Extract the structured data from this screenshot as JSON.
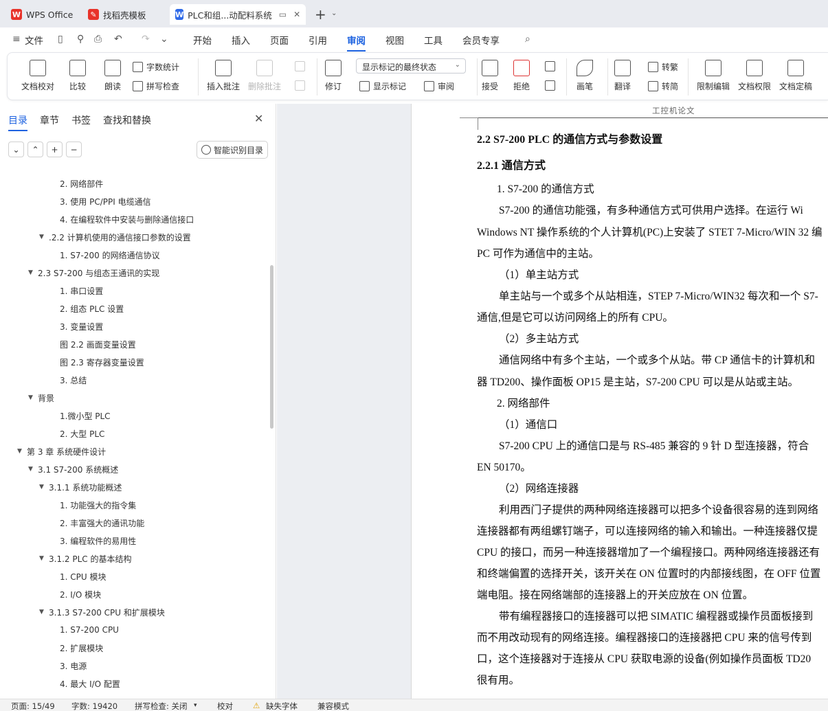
{
  "tabs": {
    "wps": "WPS Office",
    "template": "找稻壳模板",
    "doc": "PLC和组...动配料系统"
  },
  "menu": {
    "file": "文件",
    "items": [
      "开始",
      "插入",
      "页面",
      "引用",
      "审阅",
      "视图",
      "工具",
      "会员专享"
    ],
    "active": "审阅"
  },
  "ribbon": {
    "proofread": "文档校对",
    "compare": "比较",
    "read_aloud": "朗读",
    "word_count": "字数统计",
    "spell_check": "拼写检查",
    "insert_comment": "插入批注",
    "delete_comment": "删除批注",
    "track_changes": "修订",
    "markup_state": "显示标记的最终状态",
    "show_markup": "显示标记",
    "review": "审阅",
    "accept": "接受",
    "reject": "拒绝",
    "pen": "画笔",
    "translate": "翻译",
    "to_traditional": "转繁",
    "to_simplified": "转简",
    "restrict_edit": "限制编辑",
    "doc_permission": "文档权限",
    "finalize": "文档定稿"
  },
  "left_panel": {
    "tabs": [
      "目录",
      "章节",
      "书签",
      "查找和替换"
    ],
    "smart_toc": "智能识别目录",
    "toc": [
      "2. 网络部件",
      "3. 使用 PC/PPI 电缆通信",
      "4. 在编程软件中安装与删除通信接口",
      ".2.2 计算机使用的通信接口参数的设置",
      "1. S7-200 的网络通信协议",
      "2.3 S7-200 与组态王通讯的实现",
      "1. 串口设置",
      "2. 组态 PLC 设置",
      "3. 变量设置",
      "图 2.2 画面变量设置",
      "图 2.3 寄存器变量设置",
      "3. 总结",
      "背景",
      "1.微小型 PLC",
      "2. 大型 PLC",
      "第 3 章    系统硬件设计",
      "3.1 S7-200 系统概述",
      "3.1.1 系统功能概述",
      "1. 功能强大的指令集",
      "2. 丰富强大的通讯功能",
      "3. 编程软件的易用性",
      "3.1.2 PLC 的基本结构",
      "1. CPU 模块",
      "2. I/O 模块",
      "3.1.3 S7-200 CPU 和扩展模块",
      "1. S7-200 CPU",
      "2. 扩展模块",
      "3. 电源",
      "4. 最大 I/O 配置"
    ]
  },
  "document": {
    "header": "工控机论文",
    "lines": [
      "2.2 S7-200 PLC 的通信方式与参数设置",
      "2.2.1 通信方式",
      "1. S7-200 的通信方式",
      "S7-200 的通信功能强，有多种通信方式可供用户选择。在运行 Wi",
      "Windows NT 操作系统的个人计算机(PC)上安装了 STET 7-Micro/WIN 32 编",
      "PC 可作为通信中的主站。",
      "（1）单主站方式",
      "单主站与一个或多个从站相连，STEP 7-Micro/WIN32 每次和一个 S7-",
      "通信,但是它可以访问网络上的所有 CPU。",
      "（2）多主站方式",
      "通信网络中有多个主站，一个或多个从站。带 CP 通信卡的计算机和",
      "器 TD200、操作面板 OP15 是主站，S7-200 CPU 可以是从站或主站。",
      "2. 网络部件",
      "（1）通信口",
      "S7-200 CPU 上的通信口是与 RS-485 兼容的 9 针 D 型连接器，符合",
      "EN 50170。",
      "（2）网络连接器",
      "利用西门子提供的两种网络连接器可以把多个设备很容易的连到网络",
      "连接器都有两组螺钉端子，可以连接网络的输入和输出。一种连接器仅提",
      "CPU 的接口，而另一种连接器增加了一个编程接口。两种网络连接器还有",
      "和终端偏置的选择开关，该开关在 ON 位置时的内部接线图，在 OFF 位置",
      "端电阻。接在网络端部的连接器上的开关应放在 ON 位置。",
      "带有编程器接口的连接器可以把 SIMATIC 编程器或操作员面板接到",
      "而不用改动现有的网络连接。编程器接口的连接器把 CPU 来的信号传到",
      "口，这个连接器对于连接从 CPU 获取电源的设备(例如操作员面板 TD20",
      "很有用。"
    ]
  },
  "status": {
    "page": "页面: 15/49",
    "words": "字数: 19420",
    "spell": "拼写检查: 关闭",
    "proof": "校对",
    "missing_font": "缺失字体",
    "compat": "兼容模式"
  }
}
